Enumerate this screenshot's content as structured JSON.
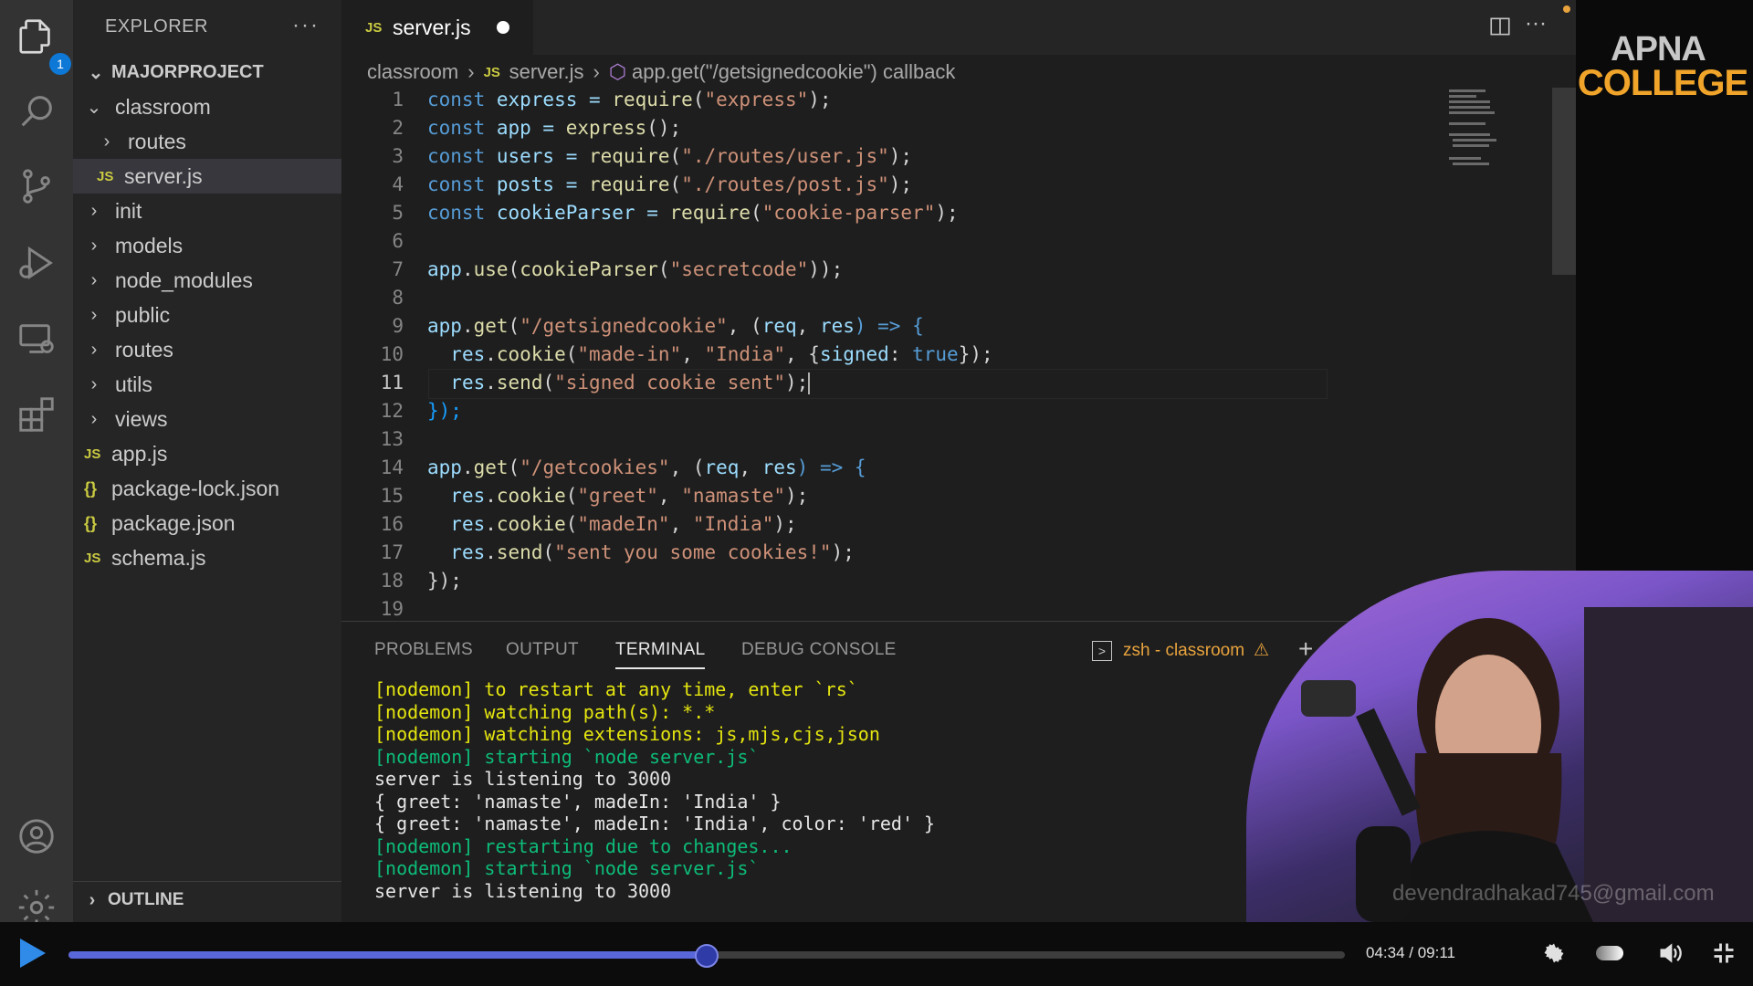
{
  "activity_bar": {
    "items": [
      {
        "name": "explorer-icon",
        "badge": "1"
      },
      {
        "name": "search-icon"
      },
      {
        "name": "source-control-icon"
      },
      {
        "name": "run-debug-icon"
      },
      {
        "name": "remote-explorer-icon"
      },
      {
        "name": "extensions-icon"
      },
      {
        "name": "account-icon"
      },
      {
        "name": "settings-gear-icon"
      }
    ]
  },
  "sidebar": {
    "title": "EXPLORER",
    "more": "···",
    "project": "MAJORPROJECT",
    "tree": [
      {
        "label": "classroom",
        "type": "folder-open",
        "depth": 1
      },
      {
        "label": "routes",
        "type": "folder",
        "depth": 2
      },
      {
        "label": "server.js",
        "type": "js",
        "depth": 2,
        "active": true
      },
      {
        "label": "init",
        "type": "folder",
        "depth": 1
      },
      {
        "label": "models",
        "type": "folder",
        "depth": 1
      },
      {
        "label": "node_modules",
        "type": "folder",
        "depth": 1
      },
      {
        "label": "public",
        "type": "folder",
        "depth": 1
      },
      {
        "label": "routes",
        "type": "folder",
        "depth": 1
      },
      {
        "label": "utils",
        "type": "folder",
        "depth": 1
      },
      {
        "label": "views",
        "type": "folder",
        "depth": 1
      },
      {
        "label": "app.js",
        "type": "js",
        "depth": 1
      },
      {
        "label": "package-lock.json",
        "type": "json",
        "depth": 1
      },
      {
        "label": "package.json",
        "type": "json",
        "depth": 1
      },
      {
        "label": "schema.js",
        "type": "js",
        "depth": 1
      }
    ],
    "outline": "OUTLINE"
  },
  "editor": {
    "tab": {
      "icon": "JS",
      "label": "server.js",
      "modified": true
    },
    "breadcrumb": {
      "folder": "classroom",
      "file": "server.js",
      "symbol": "app.get(\"/getsignedcookie\") callback"
    },
    "lines": [
      "1",
      "2",
      "3",
      "4",
      "5",
      "6",
      "7",
      "8",
      "9",
      "10",
      "11",
      "12",
      "13",
      "14",
      "15",
      "16",
      "17",
      "18",
      "19"
    ],
    "code": {
      "l1": [
        "const",
        " express = ",
        "require",
        "(",
        "\"express\"",
        ");"
      ],
      "l2": [
        "const",
        " app = ",
        "express",
        "();"
      ],
      "l3": [
        "const",
        " users = ",
        "require",
        "(",
        "\"./routes/user.js\"",
        ");"
      ],
      "l4": [
        "const",
        " posts = ",
        "require",
        "(",
        "\"./routes/post.js\"",
        ");"
      ],
      "l5": [
        "const",
        " cookieParser = ",
        "require",
        "(",
        "\"cookie-parser\"",
        ");"
      ],
      "l7": [
        "app",
        ".",
        "use",
        "(",
        "cookieParser",
        "(",
        "\"secretcode\"",
        "));"
      ],
      "l9": [
        "app",
        ".",
        "get",
        "(",
        "\"/getsignedcookie\"",
        ", (",
        "req",
        ", ",
        "res",
        ") => {"
      ],
      "l10": [
        "res",
        ".",
        "cookie",
        "(",
        "\"made-in\"",
        ", ",
        "\"India\"",
        ", {",
        "signed",
        ": ",
        "true",
        "});"
      ],
      "l11": [
        "res",
        ".",
        "send",
        "(",
        "\"signed cookie sent\"",
        ");"
      ],
      "l12": [
        "});"
      ],
      "l14": [
        "app",
        ".",
        "get",
        "(",
        "\"/getcookies\"",
        ", (",
        "req",
        ", ",
        "res",
        ") => {"
      ],
      "l15": [
        "res",
        ".",
        "cookie",
        "(",
        "\"greet\"",
        ", ",
        "\"namaste\"",
        ");"
      ],
      "l16": [
        "res",
        ".",
        "cookie",
        "(",
        "\"madeIn\"",
        ", ",
        "\"India\"",
        ");"
      ],
      "l17": [
        "res",
        ".",
        "send",
        "(",
        "\"sent you some cookies!\"",
        ");"
      ],
      "l18": [
        "});"
      ]
    }
  },
  "panel": {
    "tabs": [
      "PROBLEMS",
      "OUTPUT",
      "TERMINAL",
      "DEBUG CONSOLE"
    ],
    "active_tab": "TERMINAL",
    "terminal_name": "zsh - classroom",
    "terminal": [
      {
        "c": "yel",
        "t": "[nodemon] to restart at any time, enter `rs`"
      },
      {
        "c": "yel",
        "t": "[nodemon] watching path(s): *.*"
      },
      {
        "c": "yel",
        "t": "[nodemon] watching extensions: js,mjs,cjs,json"
      },
      {
        "c": "grn",
        "t": "[nodemon] starting `node server.js`"
      },
      {
        "c": "wht",
        "t": "server is listening to 3000"
      },
      {
        "c": "wht",
        "t": "{ greet: 'namaste', madeIn: 'India' }"
      },
      {
        "c": "wht",
        "t": "{ greet: 'namaste', madeIn: 'India', color: 'red' }"
      },
      {
        "c": "grn",
        "t": "[nodemon] restarting due to changes..."
      },
      {
        "c": "grn",
        "t": "[nodemon] starting `node server.js`"
      },
      {
        "c": "wht",
        "t": "server is listening to 3000"
      }
    ]
  },
  "branding": {
    "line1": "APNA",
    "line2": "COLLEGE",
    "watermark": "devendradhakad745@gmail.com"
  },
  "player": {
    "time": "04:34 / 09:11",
    "progress_fraction": 0.4988
  }
}
